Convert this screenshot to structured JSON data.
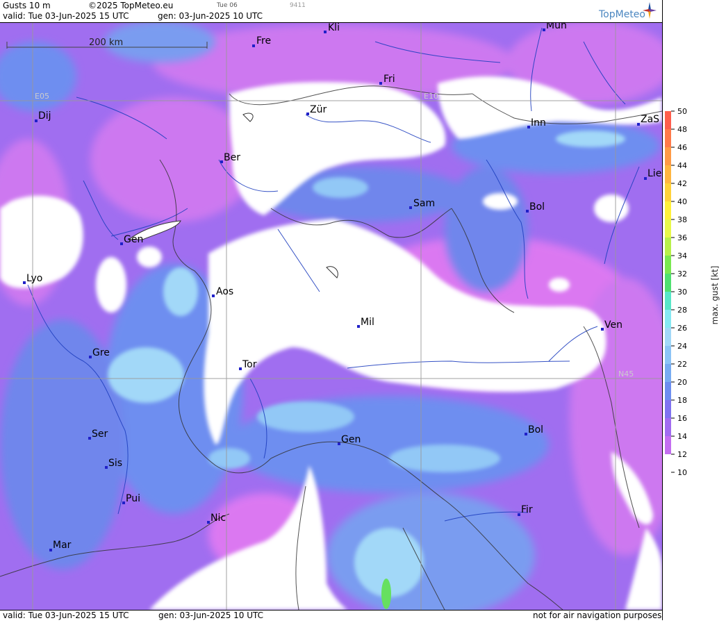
{
  "header": {
    "product": "Gusts 10 m",
    "copyright": "©2025 TopMeteo.eu",
    "day": "Tue 06",
    "code": "9411",
    "valid": "valid:  Tue  03-Jun-2025  15 UTC",
    "gen": "gen: 03-Jun-2025 10 UTC",
    "logo": "TopMeteo"
  },
  "footer": {
    "valid": "valid:  Tue   03-Jun-2025   15 UTC",
    "gen": "gen: 03-Jun-2025 10 UTC",
    "note": "not for air navigation purposes"
  },
  "scale_bar": "200 km",
  "grid_labels": {
    "lon_a": "E05",
    "lon_b": "E10",
    "lat_a": "N45"
  },
  "cities": [
    "Kli",
    "Mün",
    "Fre",
    "Fri",
    "Dij",
    "Zür",
    "Inn",
    "ZaS",
    "Ber",
    "Lie",
    "Sam",
    "Bol",
    "Gen",
    "Lyo",
    "Aos",
    "Mil",
    "Ven",
    "Gre",
    "Tor",
    "Ser",
    "Gen",
    "Bol",
    "Sis",
    "Pui",
    "Fir",
    "Nic",
    "Mar"
  ],
  "legend": {
    "axis_label": "max. gust [kt]",
    "ticks": [
      50,
      48,
      46,
      44,
      42,
      40,
      38,
      36,
      34,
      32,
      30,
      28,
      26,
      24,
      22,
      20,
      18,
      16,
      14,
      12,
      10
    ],
    "colors": [
      "#ff5e4d",
      "#ff7a4a",
      "#ff9a45",
      "#ffb640",
      "#ffd23a",
      "#fff03a",
      "#e8f84a",
      "#b8f04a",
      "#7ae850",
      "#4fe070",
      "#58e6c8",
      "#86e8f2",
      "#a2d8f8",
      "#8cc4f6",
      "#78acf2",
      "#6e8ef0",
      "#8073f0",
      "#a26cf0",
      "#c46ef0",
      "#e070f0",
      "#ffffff"
    ]
  }
}
